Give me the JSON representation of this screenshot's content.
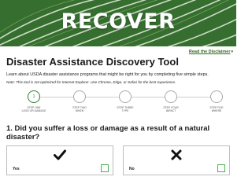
{
  "hero": {
    "title": "RECOVER"
  },
  "disclaimer": {
    "label": "Read the Disclaimer",
    "icon": "chevron-down-icon"
  },
  "page": {
    "title": "Disaster Assistance Discovery Tool",
    "intro": "Learn about USDA disaster assistance programs that might be right for you by completing five simple steps.",
    "note": "Note: This tool is not optimized for Internet Explorer. Use Chrome, Edge, or Safari for the best experience."
  },
  "steps": [
    {
      "number": "1",
      "label": "STEP ONE",
      "sub": "LOSS OR DAMAGE"
    },
    {
      "number": "",
      "label": "STEP TWO",
      "sub": "WHEN"
    },
    {
      "number": "",
      "label": "STEP THREE",
      "sub": "TYPE"
    },
    {
      "number": "",
      "label": "STEP FOUR",
      "sub": "IMPACT"
    },
    {
      "number": "",
      "label": "STEP FIVE",
      "sub": "WHERE"
    }
  ],
  "question": {
    "text": "1. Did you suffer a loss or damage as a result of a natural disaster?"
  },
  "options": [
    {
      "label": "Yes",
      "icon": "checkmark-icon"
    },
    {
      "label": "No",
      "icon": "x-icon"
    }
  ],
  "colors": {
    "accent": "#2e7d32",
    "hero": "#2f6b2e",
    "checkbox_border": "#4caf50"
  }
}
